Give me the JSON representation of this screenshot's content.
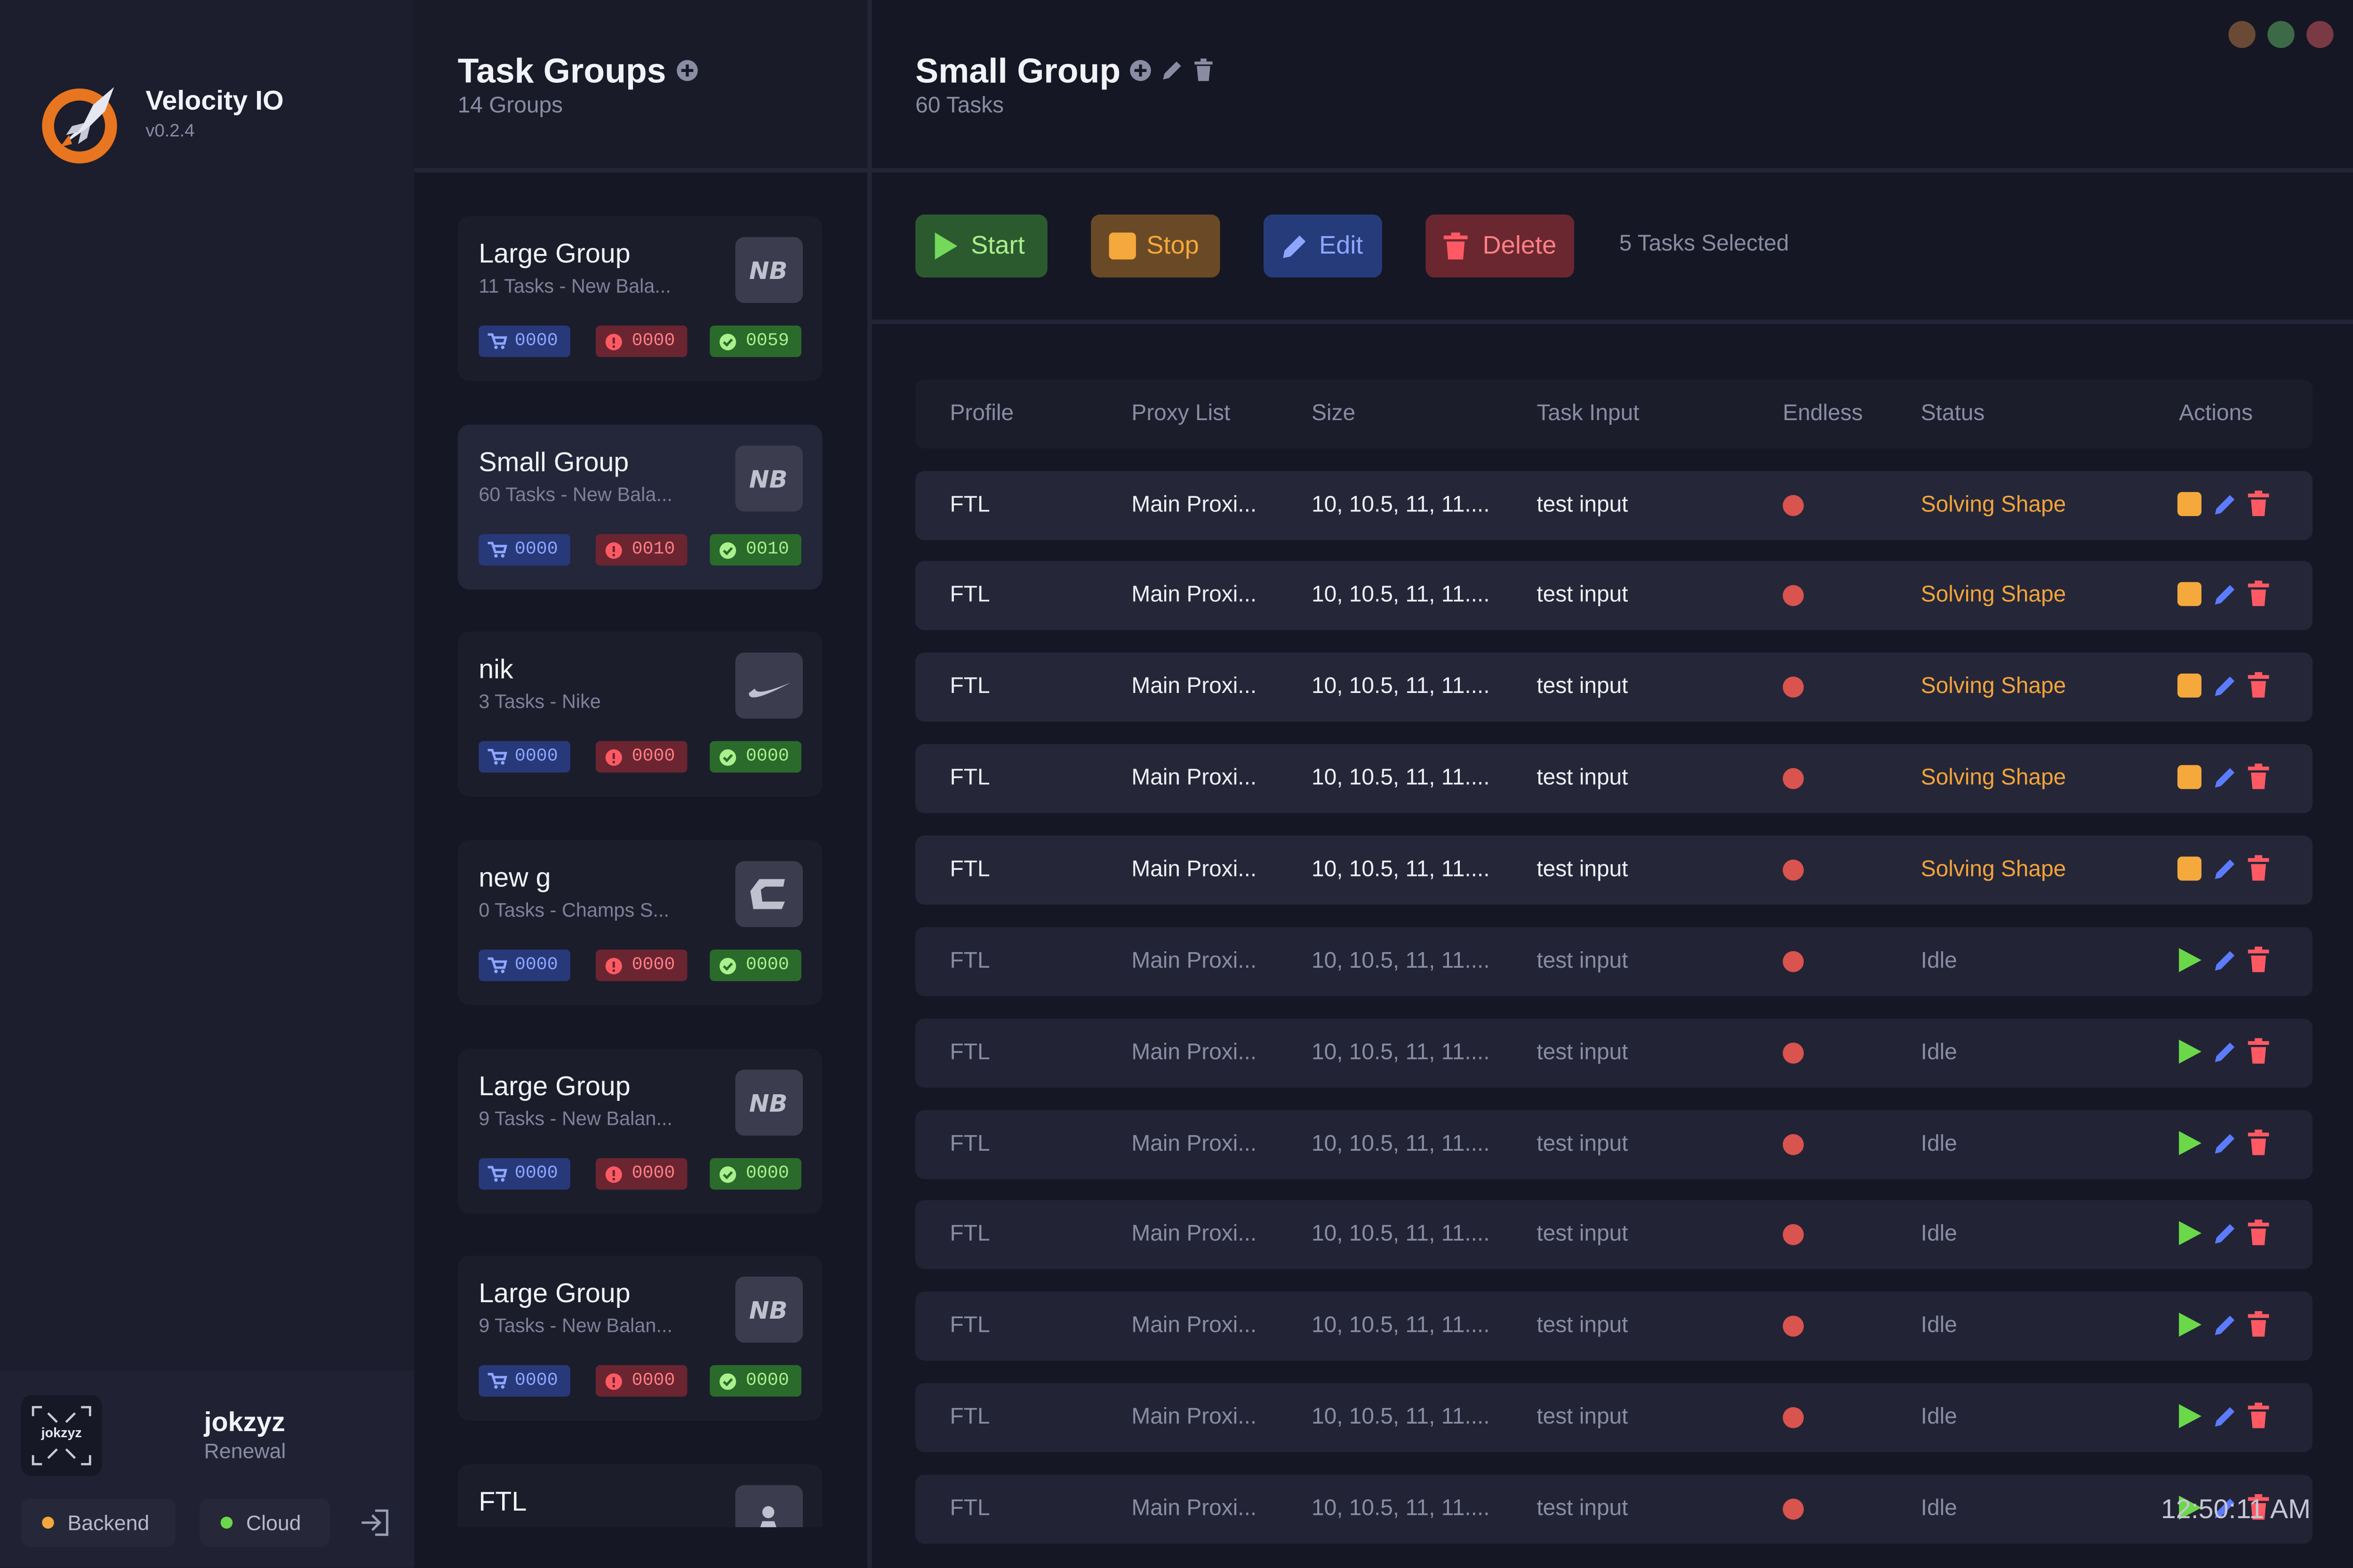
{
  "app": {
    "name": "Velocity IO",
    "version": "v0.2.4"
  },
  "user": {
    "avatar_text": "jokzyz",
    "name": "jokzyz",
    "plan": "Renewal"
  },
  "status_pills": {
    "backend": "Backend",
    "cloud": "Cloud"
  },
  "groups_panel": {
    "title": "Task Groups",
    "count": "14 Groups"
  },
  "groups": [
    {
      "name": "Large Group",
      "sub": "11 Tasks - New Bala...",
      "logo": "new-balance-logo",
      "cart": "0000",
      "failed": "0000",
      "success": "0059"
    },
    {
      "name": "Small Group",
      "sub": "60 Tasks - New Bala...",
      "logo": "new-balance-logo",
      "cart": "0000",
      "failed": "0010",
      "success": "0010"
    },
    {
      "name": "nik",
      "sub": "3 Tasks - Nike",
      "logo": "nike-logo",
      "cart": "0000",
      "failed": "0000",
      "success": "0000"
    },
    {
      "name": "new g",
      "sub": "0 Tasks - Champs S...",
      "logo": "champs-logo",
      "cart": "0000",
      "failed": "0000",
      "success": "0000"
    },
    {
      "name": "Large Group",
      "sub": "9 Tasks - New Balan...",
      "logo": "new-balance-logo",
      "cart": "0000",
      "failed": "0000",
      "success": "0000"
    },
    {
      "name": "Large Group",
      "sub": "9 Tasks - New Balan...",
      "logo": "new-balance-logo",
      "cart": "0000",
      "failed": "0000",
      "success": "0000"
    },
    {
      "name": "FTL",
      "logo": "footlocker-logo"
    }
  ],
  "detail": {
    "title": "Small Group",
    "count": "60 Tasks"
  },
  "toolbar": {
    "start": "Start",
    "stop": "Stop",
    "edit": "Edit",
    "delete": "Delete",
    "selected": "5 Tasks Selected"
  },
  "columns": [
    "Profile",
    "Proxy List",
    "Size",
    "Task Input",
    "Endless",
    "Status",
    "Actions"
  ],
  "tasks": [
    {
      "profile": "FTL",
      "proxy": "Main Proxi...",
      "size": "10, 10.5, 11, 11....",
      "input": "test input",
      "status": "Solving Shape",
      "running": true
    },
    {
      "profile": "FTL",
      "proxy": "Main Proxi...",
      "size": "10, 10.5, 11, 11....",
      "input": "test input",
      "status": "Solving Shape",
      "running": true
    },
    {
      "profile": "FTL",
      "proxy": "Main Proxi...",
      "size": "10, 10.5, 11, 11....",
      "input": "test input",
      "status": "Solving Shape",
      "running": true
    },
    {
      "profile": "FTL",
      "proxy": "Main Proxi...",
      "size": "10, 10.5, 11, 11....",
      "input": "test input",
      "status": "Solving Shape",
      "running": true
    },
    {
      "profile": "FTL",
      "proxy": "Main Proxi...",
      "size": "10, 10.5, 11, 11....",
      "input": "test input",
      "status": "Solving Shape",
      "running": true
    },
    {
      "profile": "FTL",
      "proxy": "Main Proxi...",
      "size": "10, 10.5, 11, 11....",
      "input": "test input",
      "status": "Idle",
      "running": false
    },
    {
      "profile": "FTL",
      "proxy": "Main Proxi...",
      "size": "10, 10.5, 11, 11....",
      "input": "test input",
      "status": "Idle",
      "running": false
    },
    {
      "profile": "FTL",
      "proxy": "Main Proxi...",
      "size": "10, 10.5, 11, 11....",
      "input": "test input",
      "status": "Idle",
      "running": false
    },
    {
      "profile": "FTL",
      "proxy": "Main Proxi...",
      "size": "10, 10.5, 11, 11....",
      "input": "test input",
      "status": "Idle",
      "running": false
    },
    {
      "profile": "FTL",
      "proxy": "Main Proxi...",
      "size": "10, 10.5, 11, 11....",
      "input": "test input",
      "status": "Idle",
      "running": false
    },
    {
      "profile": "FTL",
      "proxy": "Main Proxi...",
      "size": "10, 10.5, 11, 11....",
      "input": "test input",
      "status": "Idle",
      "running": false
    },
    {
      "profile": "FTL",
      "proxy": "Main Proxi...",
      "size": "10, 10.5, 11, 11....",
      "input": "test input",
      "status": "Idle",
      "running": false
    }
  ],
  "clock": "12:50:11 AM",
  "colors": {
    "accent_green": "#6bd84a",
    "accent_orange": "#f5a83b",
    "accent_blue": "#5c7cff",
    "accent_red": "#ff5a64",
    "endless_dot": "#d9534f"
  }
}
